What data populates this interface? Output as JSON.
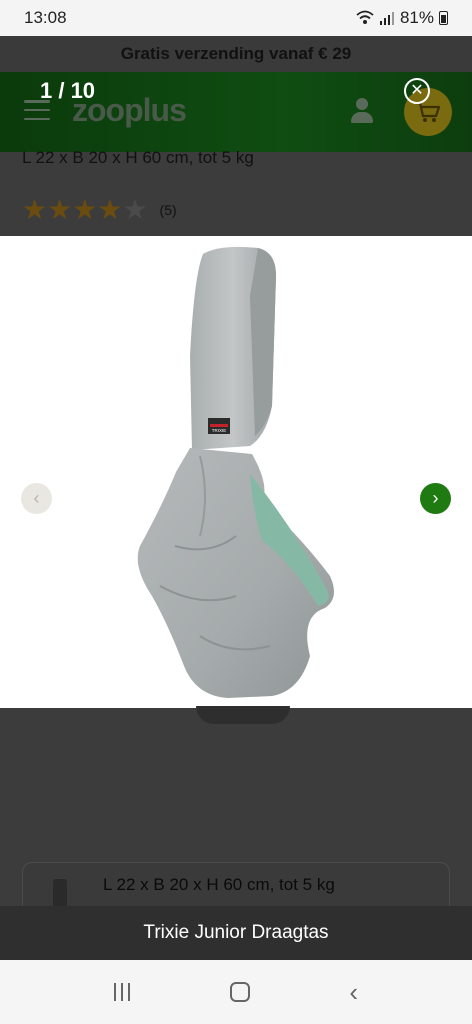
{
  "status_bar": {
    "time": "13:08",
    "battery": "81%"
  },
  "promo": {
    "text": "Gratis verzending vanaf € 29"
  },
  "header": {
    "logo": "zooplus"
  },
  "product": {
    "dimensions": "L 22 x B 20 x H 60 cm, tot 5 kg",
    "rating": {
      "filled_stars": 4,
      "max_stars": 5,
      "count_label": "(5)"
    }
  },
  "gallery": {
    "counter": "1 / 10",
    "close_glyph": "✕",
    "prev_glyph": "‹",
    "next_glyph": "›",
    "caption": "Trixie Junior Draagtas",
    "brand_tag": "TRIXIE"
  },
  "variant": {
    "label": "L 22 x B 20 x H 60 cm, tot 5 kg"
  },
  "colors": {
    "accent_green": "#1f7a12",
    "header_green": "#0f4d12",
    "cart_yellow": "#f2d21b",
    "star": "#e8a317"
  },
  "icons": [
    "wifi-icon",
    "signal-icon",
    "battery-icon",
    "hamburger-icon",
    "user-icon",
    "cart-icon",
    "close-icon",
    "chevron-left-icon",
    "chevron-right-icon",
    "recent-apps-icon",
    "home-icon",
    "back-icon"
  ]
}
